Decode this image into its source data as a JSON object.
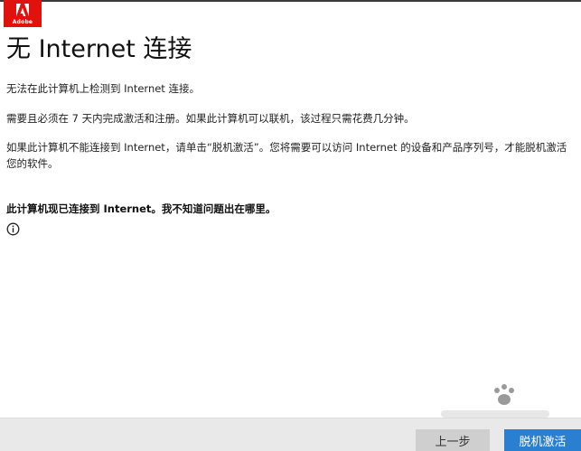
{
  "brand": {
    "logo_text": "Adobe",
    "logo_color": "#e1120d"
  },
  "page": {
    "title": "无 Internet 连接",
    "paragraphs": [
      "无法在此计算机上检测到 Internet 连接。",
      "需要且必须在 7 天内完成激活和注册。如果此计算机可以联机，该过程只需花费几分钟。",
      "如果此计算机不能连接到 Internet，请单击“脱机激活”。您将需要可以访问 Internet 的设备和产品序列号，才能脱机激活您的软件。"
    ],
    "connected_link": "此计算机现已连接到 Internet。我不知道问题出在哪里。",
    "info_icon": "info-circle-icon"
  },
  "footer": {
    "back_label": "上一步",
    "offline_label": "脱机激活",
    "primary_color": "#2b7fd0"
  },
  "watermark": {
    "name": "baidu-jingyan-watermark"
  }
}
